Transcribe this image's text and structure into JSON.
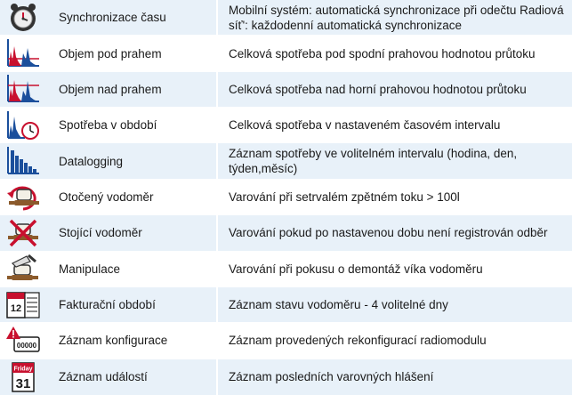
{
  "rows": [
    {
      "icon": "clock-sync-icon",
      "name": "Synchronizace času",
      "desc": "Mobilní systém: automatická synchronizace při odečtu Radiová síť': každodenní automatická synchronizace"
    },
    {
      "icon": "chart-below-threshold-icon",
      "name": "Objem pod prahem",
      "desc": "Celková spotřeba pod spodní prahovou hodnotou průtoku"
    },
    {
      "icon": "chart-above-threshold-icon",
      "name": "Objem nad prahem",
      "desc": "Celková spotřeba nad horní prahovou hodnotou průtoku"
    },
    {
      "icon": "chart-clock-icon",
      "name": "Spotřeba v období",
      "desc": "Celková spotřeba v nastaveném časovém intervalu"
    },
    {
      "icon": "datalogging-chart-icon",
      "name": "Datalogging",
      "desc": "Záznam spotřeby ve volitelném intervalu (hodina, den, týden,měsíc)"
    },
    {
      "icon": "reversed-meter-icon",
      "name": "Otočený vodoměr",
      "desc": "Varování při setrvalém zpětném toku > 100l"
    },
    {
      "icon": "stopped-meter-icon",
      "name": "Stojící vodoměr",
      "desc": "Varování pokud po nastavenou dobu není registrován odběr"
    },
    {
      "icon": "tamper-meter-icon",
      "name": "Manipulace",
      "desc": "Varování při pokusu o demontáž víka vodoměru"
    },
    {
      "icon": "billing-calendar-icon",
      "name": "Fakturační období",
      "desc": "Záznam stavu vodoměru - 4 volitelné dny"
    },
    {
      "icon": "config-warning-icon",
      "name": "Záznam konfigurace",
      "desc": "Záznam provedených rekonfigurací radiomodulu"
    },
    {
      "icon": "event-calendar-icon",
      "name": "Záznam událostí",
      "desc": "Záznam posledních varovných hlášení"
    }
  ],
  "icon_text": {
    "calendar_day_name": "Friday",
    "calendar_day_number": "31",
    "billing_number": "12",
    "config_counter": "00000"
  },
  "colors": {
    "row_alt": "#e8f1f9",
    "chart_blue": "#1b4f9c",
    "chart_red": "#c8102e"
  }
}
